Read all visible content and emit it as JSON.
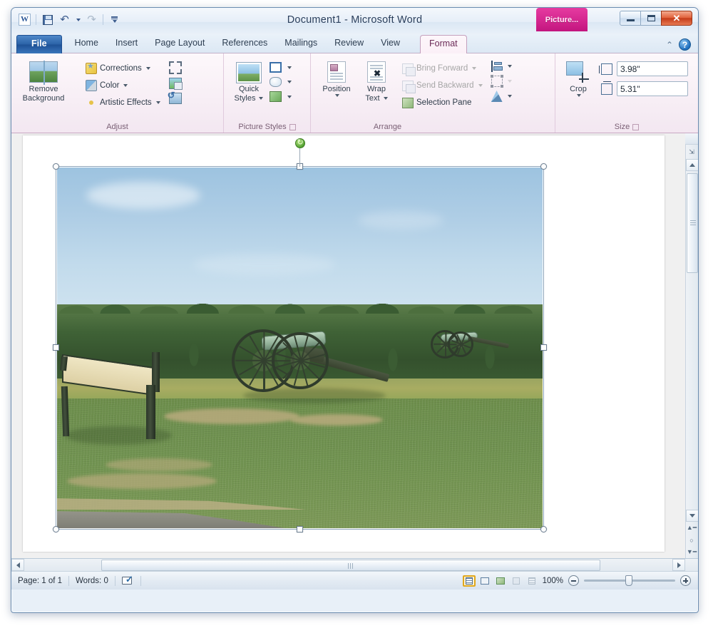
{
  "window": {
    "title": "Document1 - Microsoft Word",
    "contextual_tab": "Picture...",
    "minimize": "Minimize",
    "maximize": "Maximize",
    "close": "✕"
  },
  "quick_access": {
    "logo": "W",
    "save": "save-icon",
    "undo": "undo-icon",
    "redo": "redo-icon",
    "customize": "customize-icon"
  },
  "tabs": [
    {
      "label": "File",
      "active": false
    },
    {
      "label": "Home",
      "active": false
    },
    {
      "label": "Insert",
      "active": false
    },
    {
      "label": "Page Layout",
      "active": false
    },
    {
      "label": "References",
      "active": false
    },
    {
      "label": "Mailings",
      "active": false
    },
    {
      "label": "Review",
      "active": false
    },
    {
      "label": "View",
      "active": false
    },
    {
      "label": "Format",
      "active": true
    }
  ],
  "ribbon_right": {
    "minimize_ribbon": "⌃",
    "help": "?"
  },
  "ribbon": {
    "adjust": {
      "label": "Adjust",
      "remove_background_line1": "Remove",
      "remove_background_line2": "Background",
      "corrections": "Corrections",
      "color": "Color",
      "artistic_effects": "Artistic Effects",
      "compress_pictures": "compress-pictures-icon",
      "change_picture": "change-picture-icon",
      "reset_picture": "reset-picture-icon"
    },
    "picture_styles": {
      "label": "Picture Styles",
      "quick_styles_line1": "Quick",
      "quick_styles_line2": "Styles",
      "picture_border": "picture-border-icon",
      "picture_effects": "picture-effects-icon",
      "picture_layout": "picture-layout-icon"
    },
    "arrange": {
      "label": "Arrange",
      "position": "Position",
      "wrap_text_line1": "Wrap",
      "wrap_text_line2": "Text",
      "bring_forward": "Bring Forward",
      "send_backward": "Send Backward",
      "selection_pane": "Selection Pane",
      "align": "align-icon",
      "group": "group-icon",
      "rotate": "rotate-icon"
    },
    "size": {
      "label": "Size",
      "crop": "Crop",
      "shape_height_label": "Shape Height",
      "shape_height_value": "3.98\"",
      "shape_width_label": "Shape Width",
      "shape_width_value": "5.31\""
    }
  },
  "document": {
    "picture_alt": "Civil War battlefield photo with two cannons, interpretive sign and tree line",
    "selected": true
  },
  "status_bar": {
    "page": "Page: 1 of 1",
    "words": "Words: 0",
    "proofing": "proofing-errors-icon",
    "views": [
      {
        "name": "print-layout",
        "selected": true
      },
      {
        "name": "full-screen-reading",
        "selected": false
      },
      {
        "name": "web-layout",
        "selected": false
      },
      {
        "name": "outline",
        "selected": false
      },
      {
        "name": "draft",
        "selected": false
      }
    ],
    "zoom_level": "100%",
    "zoom_out": "−",
    "zoom_in": "+"
  },
  "colors": {
    "accent_contextual": "#d4268f",
    "file_tab": "#2b63a8",
    "close_button": "#c33a18",
    "selected_view": "#e0a71d"
  }
}
